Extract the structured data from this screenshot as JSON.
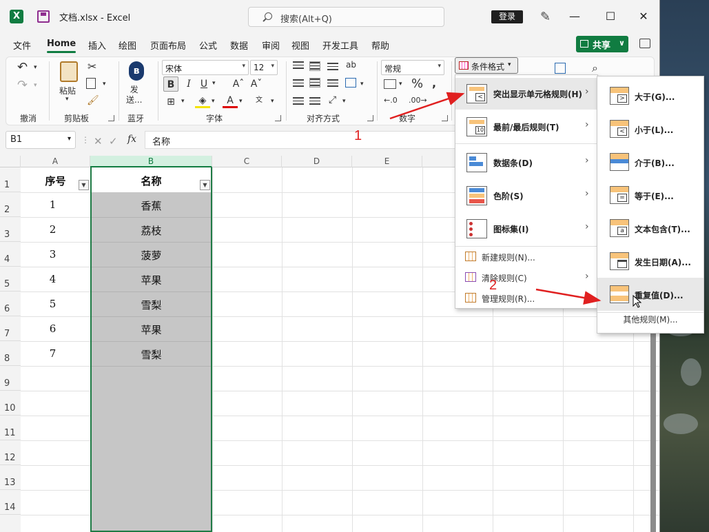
{
  "window": {
    "doc_title": "文档.xlsx  -  Excel",
    "search_placeholder": "搜索(Alt+Q)",
    "login": "登录"
  },
  "menu_tabs": [
    "文件",
    "Home",
    "插入",
    "绘图",
    "页面布局",
    "公式",
    "数据",
    "审阅",
    "视图",
    "开发工具",
    "帮助"
  ],
  "active_tab": "Home",
  "share_label": "共享",
  "ribbon": {
    "groups": {
      "undo": "撤消",
      "clipboard": "剪贴板",
      "bluetooth": "蓝牙",
      "font": "字体",
      "alignment": "对齐方式",
      "number": "数字"
    },
    "paste": "粘贴",
    "send": "发\n送...",
    "font_name": "宋体",
    "font_size": "12",
    "number_format": "常规",
    "conditional_format": "条件格式"
  },
  "formula_bar": {
    "name_box": "B1",
    "fx": "fx",
    "formula": "名称"
  },
  "sheet": {
    "columns": [
      "A",
      "B",
      "C",
      "D",
      "E"
    ],
    "rows": [
      "1",
      "2",
      "3",
      "4",
      "5",
      "6",
      "7",
      "8",
      "9",
      "10",
      "11",
      "12",
      "13",
      "14"
    ],
    "header_a": "序号",
    "header_b": "名称",
    "data": [
      {
        "no": "1",
        "name": "香蕉"
      },
      {
        "no": "2",
        "name": "荔枝"
      },
      {
        "no": "3",
        "name": "菠萝"
      },
      {
        "no": "4",
        "name": "苹果"
      },
      {
        "no": "5",
        "name": "雪梨"
      },
      {
        "no": "6",
        "name": "苹果"
      },
      {
        "no": "7",
        "name": "雪梨"
      }
    ]
  },
  "cond_menu": {
    "items": [
      {
        "label": "突出显示单元格规则(H)",
        "icon": "highlight-rules-icon"
      },
      {
        "label": "最前/最后规则(T)",
        "icon": "top-bottom-icon"
      },
      {
        "label": "数据条(D)",
        "icon": "data-bars-icon"
      },
      {
        "label": "色阶(S)",
        "icon": "color-scale-icon"
      },
      {
        "label": "图标集(I)",
        "icon": "icon-sets-icon"
      }
    ],
    "new_rule": "新建规则(N)...",
    "clear_rules": "清除规则(C)",
    "manage_rules": "管理规则(R)..."
  },
  "highlight_submenu": {
    "items": [
      {
        "label": "大于(G)...",
        "sym": ">"
      },
      {
        "label": "小于(L)...",
        "sym": "<"
      },
      {
        "label": "介于(B)...",
        "sym": ""
      },
      {
        "label": "等于(E)...",
        "sym": "="
      },
      {
        "label": "文本包含(T)...",
        "sym": "a"
      },
      {
        "label": "发生日期(A)...",
        "sym": ""
      },
      {
        "label": "重复值(D)...",
        "sym": ""
      }
    ],
    "other_rules": "其他规则(M)..."
  },
  "annotations": [
    "1",
    "2"
  ],
  "colors": {
    "excel_green": "#107c41",
    "selection_fill": "#c6c6c6",
    "annotation_red": "#e02020"
  }
}
